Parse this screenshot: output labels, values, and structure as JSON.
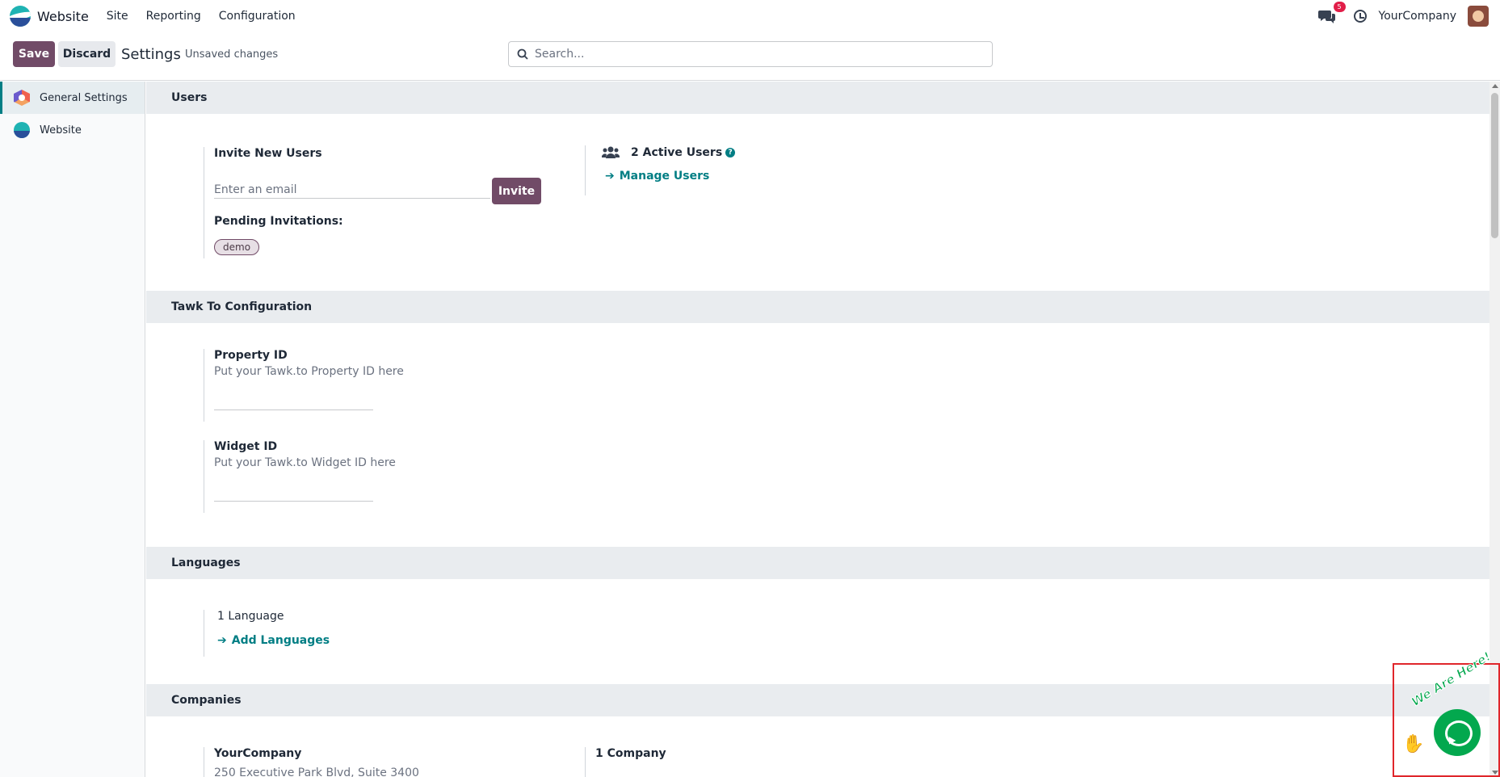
{
  "navbar": {
    "app_name": "Website",
    "menu": [
      "Site",
      "Reporting",
      "Configuration"
    ],
    "messages_badge": "5",
    "company": "YourCompany"
  },
  "control_panel": {
    "save_label": "Save",
    "discard_label": "Discard",
    "breadcrumb": "Settings",
    "status": "Unsaved changes",
    "search_placeholder": "Search..."
  },
  "sidebar": {
    "items": [
      {
        "label": "General Settings",
        "icon": "general-settings-icon",
        "active": true
      },
      {
        "label": "Website",
        "icon": "website-app-icon",
        "active": false
      }
    ]
  },
  "sections": {
    "users": {
      "title": "Users",
      "invite_label": "Invite New Users",
      "email_placeholder": "Enter an email",
      "invite_button": "Invite",
      "pending_label": "Pending Invitations:",
      "pending_tags": [
        "demo"
      ],
      "active_users": "2 Active Users",
      "manage_users": "Manage Users"
    },
    "tawk": {
      "title": "Tawk To Configuration",
      "property_label": "Property ID",
      "property_desc": "Put your Tawk.to Property ID here",
      "property_value": "",
      "widget_label": "Widget ID",
      "widget_desc": "Put your Tawk.to Widget ID here",
      "widget_value": ""
    },
    "languages": {
      "title": "Languages",
      "count": "1 Language",
      "add_link": "Add Languages"
    },
    "companies": {
      "title": "Companies",
      "company_name": "YourCompany",
      "company_address": "250 Executive Park Blvd, Suite 3400",
      "count": "1 Company"
    }
  },
  "chat_widget": {
    "text": "We Are Here!",
    "color": "#03a84e",
    "highlight_color": "#e0262b"
  },
  "colors": {
    "primary": "#714b67",
    "link": "#017e84"
  }
}
